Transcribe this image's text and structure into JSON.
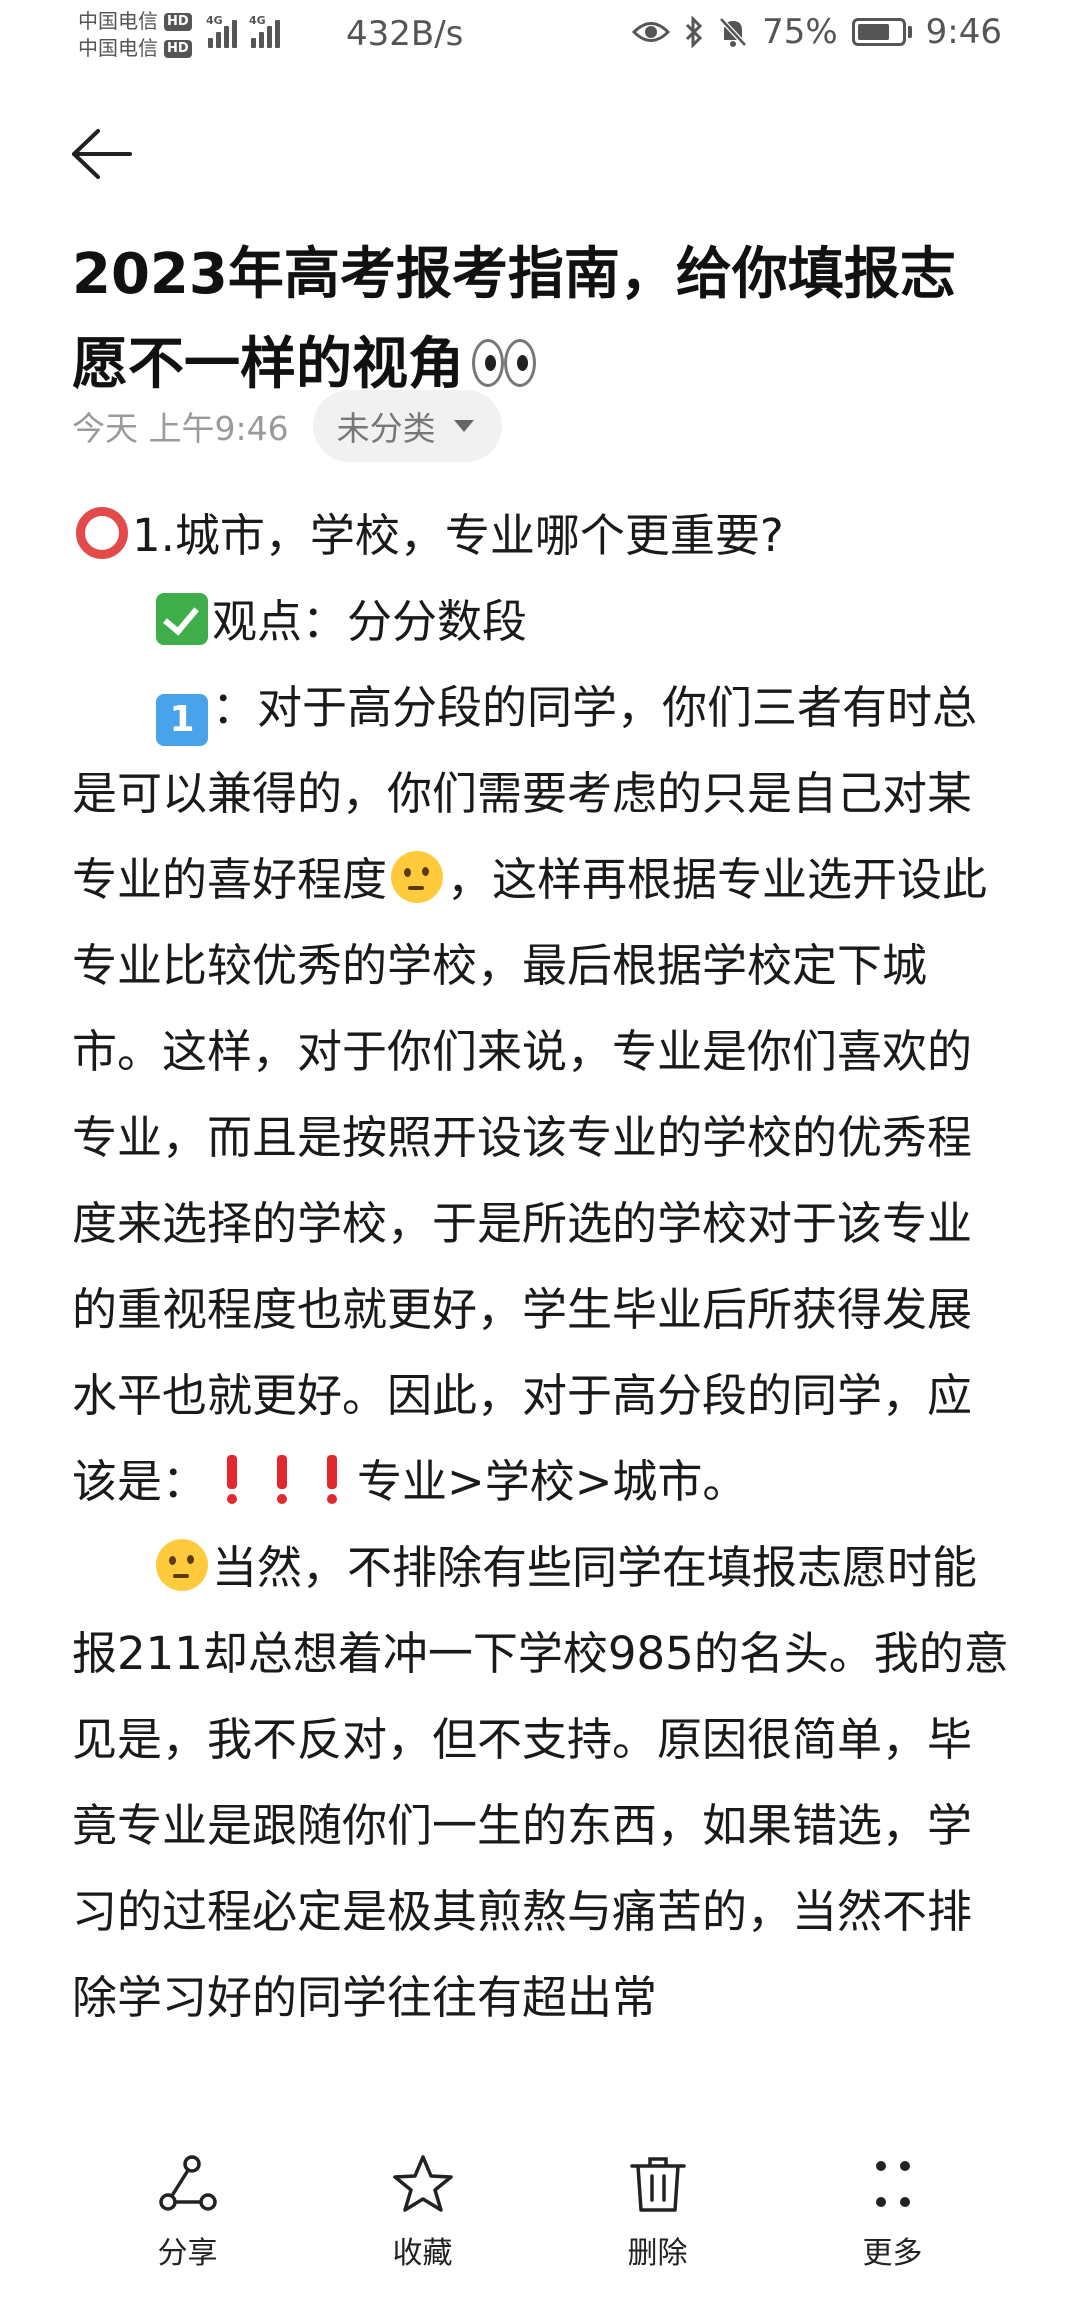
{
  "status_bar": {
    "carrier_1": "中国电信",
    "carrier_2": "中国电信",
    "hd": "HD",
    "net_tag": "4G",
    "net_speed": "432B/s",
    "battery": "75%",
    "battery_level": 0.75,
    "time": "9:46"
  },
  "note": {
    "title": "2023年高考报考指南，给你填报志愿不一样的视角",
    "time": "今天 上午9:46",
    "category": "未分类",
    "q1": "1.城市，学校，专业哪个更重要?",
    "viewpoint": "观点：分分数段",
    "p1_keycap": "1",
    "p1_a": "：对于高分段的同学，你们三者有时总是可以兼得的，你们需要考虑的只是自己对某专业的喜好程度",
    "p1_b": "，这样再根据专业选开设此专业比较优秀的学校，最后根据学校定下城市。这样，对于你们来说，专业是你们喜欢的专业，而且是按照开设该专业的学校的优秀程度来选择的学校，于是所选的学校对于该专业的重视程度也就更好，学生毕业后所获得发展水平也就更好。因此，对于高分段的同学，应该是：",
    "p1_c": "专业>学校>城市。",
    "p2": "当然，不排除有些同学在填报志愿时能报211却总想着冲一下学校985的名头。我的意见是，我不反对，但不支持。原因很简单，毕竟专业是跟随你们一生的东西，如果错选，学习的过程必定是极其煎熬与痛苦的，当然不排除学习好的同学往往有超出常"
  },
  "toolbar": {
    "share": "分享",
    "favorite": "收藏",
    "delete": "删除",
    "more": "更多"
  },
  "icons": {
    "back": "back-arrow-icon",
    "share": "share-icon",
    "favorite": "star-icon",
    "delete": "trash-icon",
    "more": "more-dots-icon"
  },
  "colors": {
    "text": "#1a1a1a",
    "secondary": "#9a9a9a",
    "chip_bg": "#f1f1f1",
    "alert_red": "#e0282e"
  }
}
